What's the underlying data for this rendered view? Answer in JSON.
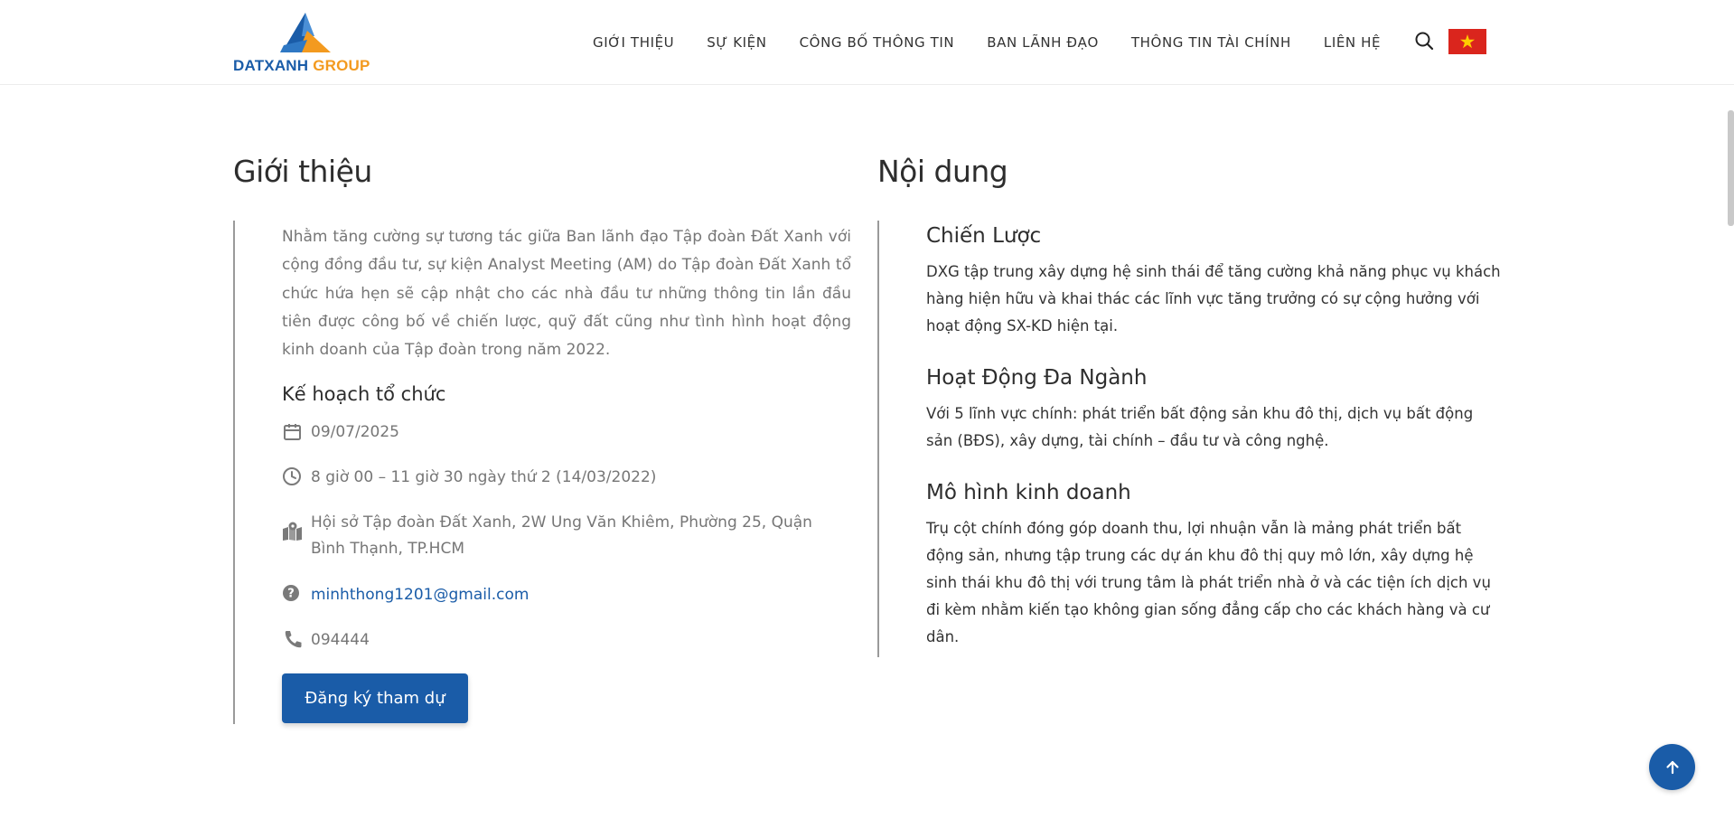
{
  "header": {
    "logo": {
      "text_primary": "DATXANH",
      "text_secondary": "GROUP"
    },
    "nav": [
      {
        "label": "GIỚI THIỆU"
      },
      {
        "label": "SỰ KIỆN"
      },
      {
        "label": "CÔNG BỐ THÔNG TIN"
      },
      {
        "label": "BAN LÃNH ĐẠO"
      },
      {
        "label": "THÔNG TIN TÀI CHÍNH"
      },
      {
        "label": "LIÊN HỆ"
      }
    ],
    "icons": {
      "search": "search-icon",
      "language": "vietnam-flag-icon"
    }
  },
  "intro": {
    "title": "Giới thiệu",
    "text": "Nhằm tăng cường sự tương tác giữa Ban lãnh đạo Tập đoàn Đất Xanh với cộng đồng đầu tư, sự kiện Analyst Meeting (AM) do Tập đoàn Đất Xanh tổ chức hứa hẹn sẽ cập nhật cho các nhà đầu tư những thông tin lần đầu tiên được công bố về chiến lược, quỹ đất cũng như tình hình hoạt động kinh doanh của Tập đoàn trong năm 2022.",
    "plan_title": "Kế hoạch tổ chức",
    "date": "09/07/2025",
    "time": "8 giờ 00 – 11 giờ 30 ngày thứ 2 (14/03/2022)",
    "location": "Hội sở Tập đoàn Đất Xanh, 2W Ung Văn Khiêm, Phường 25, Quận Bình Thạnh, TP.HCM",
    "email": "minhthong1201@gmail.com",
    "phone": "094444",
    "register_label": "Đăng ký tham dự"
  },
  "content": {
    "title": "Nội dung",
    "blocks": [
      {
        "heading": "Chiến Lược",
        "text": "DXG tập trung xây dựng hệ sinh thái để tăng cường khả năng phục vụ khách hàng hiện hữu và khai thác các lĩnh vực tăng trưởng có sự cộng hưởng với hoạt động SX-KD hiện tại."
      },
      {
        "heading": "Hoạt Động Đa Ngành",
        "text": "Với 5 lĩnh vực chính: phát triển bất động sản khu đô thị, dịch vụ bất động sản (BĐS), xây dựng, tài chính – đầu tư và công nghệ."
      },
      {
        "heading": "Mô hình kinh doanh",
        "text": "Trụ cột chính đóng góp doanh thu, lợi nhuận vẫn là mảng phát triển bất động sản, nhưng tập trung các dự án khu đô thị quy mô lớn, xây dựng hệ sinh thái khu đô thị với trung tâm là phát triển nhà ở và các tiện ích dịch vụ đi kèm nhằm kiến tạo không gian sống đẳng cấp cho các khách hàng và cư dân."
      }
    ]
  },
  "colors": {
    "brand_blue": "#1a5ca8",
    "brand_orange": "#f39a1f",
    "muted_text": "#767676"
  }
}
